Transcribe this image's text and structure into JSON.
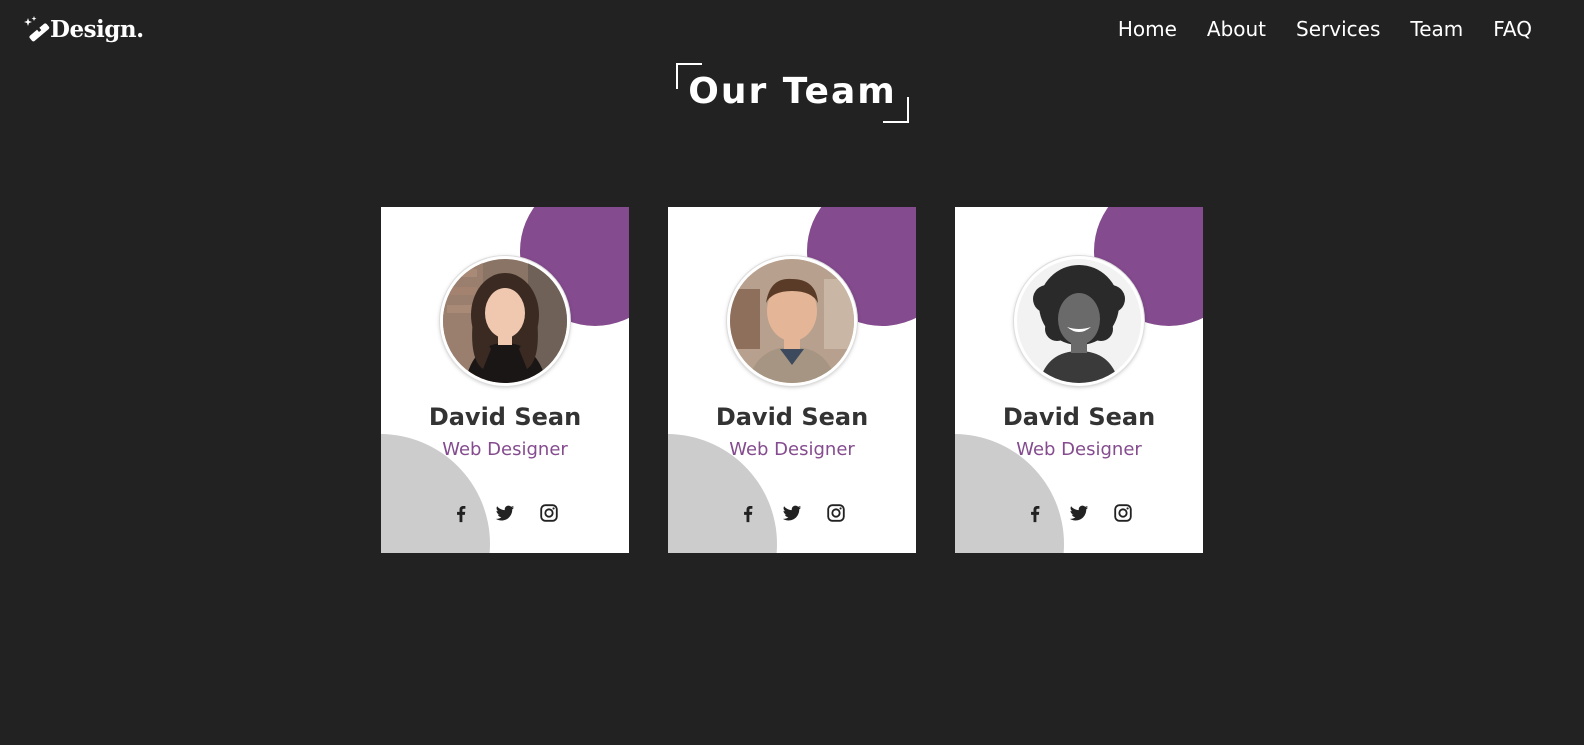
{
  "brand": {
    "logo_text": "Design.",
    "logo_icon": "magic-wand-icon"
  },
  "nav": {
    "items": [
      {
        "label": "Home"
      },
      {
        "label": "About"
      },
      {
        "label": "Services"
      },
      {
        "label": "Team"
      },
      {
        "label": "FAQ"
      }
    ]
  },
  "section": {
    "title": "Our Team"
  },
  "colors": {
    "background": "#222222",
    "accent": "#844b8e",
    "card": "#ffffff",
    "blob_gray": "#cccccc",
    "text_dark": "#333333"
  },
  "team": [
    {
      "name": "David Sean",
      "role": "Web Designer",
      "photo": "woman-brown-hair-photo",
      "socials": [
        "facebook-icon",
        "twitter-icon",
        "instagram-icon"
      ]
    },
    {
      "name": "David Sean",
      "role": "Web Designer",
      "photo": "man-short-hair-photo",
      "socials": [
        "facebook-icon",
        "twitter-icon",
        "instagram-icon"
      ]
    },
    {
      "name": "David Sean",
      "role": "Web Designer",
      "photo": "woman-curly-hair-bw-photo",
      "socials": [
        "facebook-icon",
        "twitter-icon",
        "instagram-icon"
      ]
    }
  ]
}
